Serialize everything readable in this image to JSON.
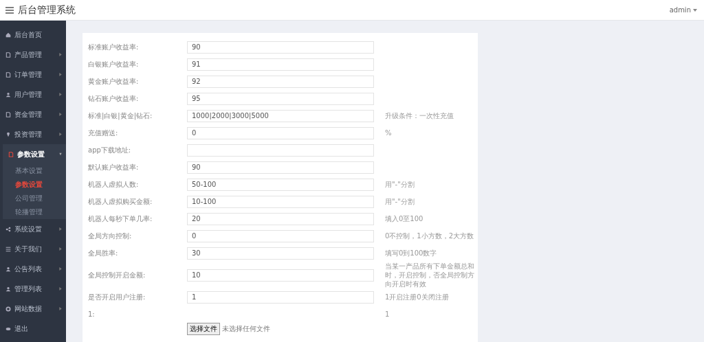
{
  "header": {
    "title": "后台管理系统",
    "user": "admin"
  },
  "sidebar": {
    "items": [
      {
        "label": "后台首页"
      },
      {
        "label": "产品管理",
        "expanded": false
      },
      {
        "label": "订单管理",
        "expanded": false
      },
      {
        "label": "用户管理",
        "expanded": false
      },
      {
        "label": "资金管理",
        "expanded": false
      },
      {
        "label": "投资管理",
        "expanded": false
      },
      {
        "label": "参数设置",
        "expanded": true,
        "children": [
          {
            "label": "基本设置",
            "selected": false
          },
          {
            "label": "参数设置",
            "selected": true
          },
          {
            "label": "公司管理",
            "selected": false
          },
          {
            "label": "轮播管理",
            "selected": false
          }
        ]
      },
      {
        "label": "系统设置",
        "expanded": false
      },
      {
        "label": "关于我们",
        "expanded": false
      },
      {
        "label": "公告列表",
        "expanded": false
      },
      {
        "label": "管理列表",
        "expanded": false
      },
      {
        "label": "网站数据",
        "expanded": false
      },
      {
        "label": "退出"
      }
    ]
  },
  "form": {
    "rows": [
      {
        "label": "标准账户收益率:",
        "value": "90"
      },
      {
        "label": "白银账户收益率:",
        "value": "91"
      },
      {
        "label": "黄金账户收益率:",
        "value": "92"
      },
      {
        "label": "钻石账户收益率:",
        "value": "95"
      },
      {
        "label": "标准|白银|黄金|钻石:",
        "value": "1000|2000|3000|5000",
        "note": "升级条件：一次性充值"
      },
      {
        "label": "充值赠送:",
        "value": "0",
        "note": "%"
      },
      {
        "label": "app下载地址:",
        "value": ""
      },
      {
        "label": "默认账户收益率:",
        "value": "90"
      },
      {
        "label": "机器人虚拟人数:",
        "value": "50-100",
        "note": "用\"-\"分割"
      },
      {
        "label": "机器人虚拟购买金额:",
        "value": "10-100",
        "note": "用\"-\"分割"
      },
      {
        "label": "机器人每秒下单几率:",
        "value": "20",
        "note": "填入0至100"
      },
      {
        "label": "全局方向控制:",
        "value": "0",
        "note": "0不控制，1小方数，2大方数"
      },
      {
        "label": "全局胜率:",
        "value": "30",
        "note": "填写0到100数字"
      },
      {
        "label": "全局控制开启金额:",
        "value": "10",
        "note": "当某一产品所有下单金额总和时，开启控制，否全局控制方向开启时有效"
      },
      {
        "label": "是否开启用户注册:",
        "value": "1",
        "note": "1开启注册0关闭注册"
      }
    ],
    "file_row": {
      "label": "1:",
      "note": "1",
      "button": "选择文件",
      "status": "未选择任何文件"
    }
  }
}
